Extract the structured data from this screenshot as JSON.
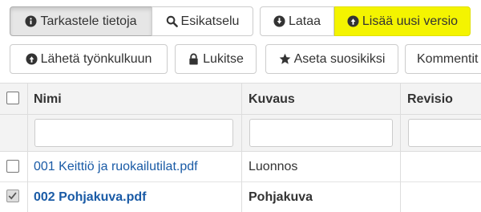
{
  "toolbar": {
    "row1": {
      "view_details": "Tarkastele tietoja",
      "preview": "Esikatselu",
      "download": "Lataa",
      "add_version": "Lisää uusi versio"
    },
    "row2": {
      "send_workflow": "Lähetä työnkulkuun",
      "lock": "Lukitse",
      "favorite": "Aseta suosikiksi",
      "comment": "Kommentit"
    }
  },
  "table": {
    "columns": [
      "Nimi",
      "Kuvaus",
      "Revisio"
    ],
    "rows": [
      {
        "name": "001 Keittiö ja ruokailutilat.pdf",
        "description": "Luonnos",
        "revision": "",
        "selected": false
      },
      {
        "name": "002 Pohjakuva.pdf",
        "description": "Pohjakuva",
        "revision": "",
        "selected": true
      }
    ]
  },
  "colors": {
    "highlight": "#f4f400",
    "link": "#1a5ba6"
  }
}
